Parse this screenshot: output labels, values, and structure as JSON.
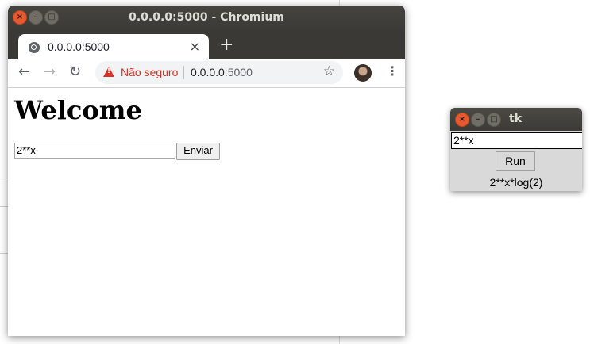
{
  "chromium": {
    "window_title": "0.0.0.0:5000 - Chromium",
    "controls": {
      "close": "×",
      "minimize": "–",
      "maximize": "□"
    },
    "tab": {
      "title": "0.0.0.0:5000",
      "close": "×"
    },
    "new_tab": "+",
    "toolbar": {
      "back": "←",
      "forward": "→",
      "reload": "↻",
      "security_label": "Não seguro",
      "url_host": "0.0.0.0",
      "url_port": ":5000",
      "bookmark_star": "☆",
      "menu": "⋮"
    },
    "page": {
      "heading": "Welcome",
      "input_value": "2**x",
      "submit_label": "Enviar"
    }
  },
  "tk": {
    "window_title": "tk",
    "controls": {
      "close": "×",
      "minimize": "–",
      "maximize": "□"
    },
    "entry_value": "2**x",
    "run_label": "Run",
    "result": "2**x*log(2)"
  },
  "colors": {
    "titlebar": "#3b3a36",
    "close_button": "#e75a2f",
    "insecure_red": "#d93025"
  }
}
